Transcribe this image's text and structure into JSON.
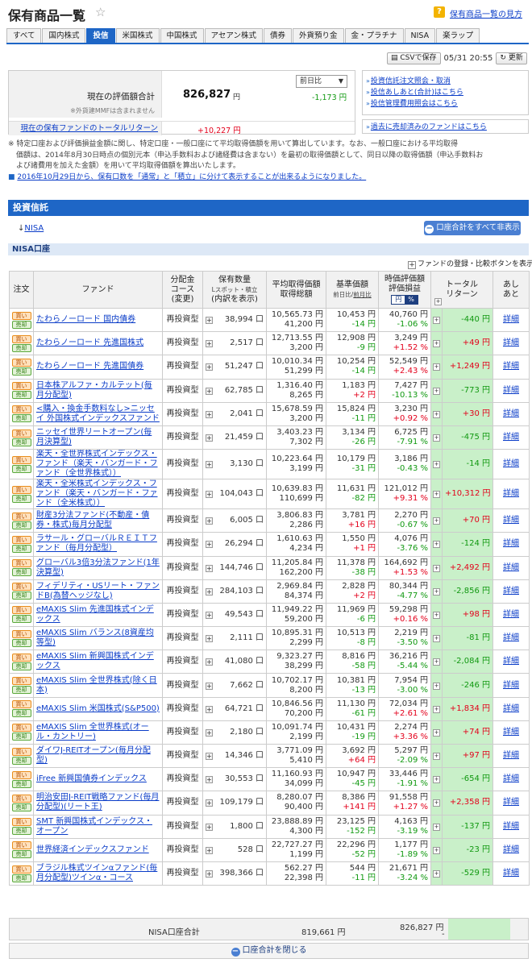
{
  "header": {
    "title": "保有商品一覧",
    "help": "保有商品一覧の見方"
  },
  "tabs": [
    "すべて",
    "国内株式",
    "投信",
    "米国株式",
    "中国株式",
    "アセアン株式",
    "債券",
    "外貨預り金",
    "金・プラチナ",
    "NISA",
    "楽ラップ"
  ],
  "active_tab": "投信",
  "toolbar": {
    "csv": "CSVで保存",
    "datetime": "05/31 20:55",
    "refresh": "更新"
  },
  "summary": {
    "value_label": "現在の評価額合計",
    "note": "※外貨建MMFは含まれません",
    "value": "826,827",
    "yen": "円",
    "compare_select": "前日比",
    "diff": "-1,173 円",
    "total_return_label": "現在の保有ファンドのトータルリターン",
    "total_return": "+10,227 円"
  },
  "links": [
    "投資信託注文照会・取消",
    "投信あしあと(合計)はこちら",
    "投信管理費用照会はこちら"
  ],
  "link_sold": "過去に売却済みのファンドはこちら",
  "notes": {
    "line1": "※ 特定口座および評価損益金額に関し、特定口座・一般口座にて平均取得価額を用いて算出しています。なお、一般口座における平均取得",
    "line2": "価額は、2014年8月30日時点の個別元本（申込手数料および諸経費は含まない）を最初の取得価額として、同日以降の取得価額（申込手数料お",
    "line3": "よび諸費用を加えた金額）を用いて平均取得価額を算出いたします。",
    "link": "2016年10月29日から、保有口数を「通常」と「積立」に分けて表示することが出来るようになりました。"
  },
  "section": {
    "title": "投資信託",
    "nisa_link": "NISA",
    "close_all": "口座合計をすべて非表示",
    "account": "NISA口座",
    "register_compare": "ファンドの登録・比較ボタンを表示"
  },
  "table": {
    "headers": {
      "order": "注文",
      "fund": "ファンド",
      "course1": "分配金",
      "course2": "コース",
      "course3": "(変更)",
      "qty1": "保有数量",
      "qty2": "Lスポット・積立",
      "qty3": "(内訳を表示)",
      "avg1": "平均取得価額",
      "avg2": "取得総額",
      "base1": "基準価額",
      "base2a": "前日比",
      "base2b": "前月比",
      "eval1": "時価評価額",
      "eval2": "評価損益",
      "pct_yen": "円",
      "pct_pct": "%",
      "ret1": "トータル",
      "ret2": "リターン",
      "ashi1": "あし",
      "ashi2": "あと"
    },
    "buy": "買い",
    "sell": "売却",
    "course": "再投資型",
    "unit": "口",
    "detail": "詳細",
    "rows": [
      {
        "name": "たわらノーロード 国内債券",
        "qty": "38,994",
        "avg": "10,565.73 円",
        "cost": "41,200 円",
        "base": "10,453 円",
        "bdiff": "-14 円",
        "eval": "40,760 円",
        "epct": "-1.06 %",
        "ret": "-440 円"
      },
      {
        "name": "たわらノーロード 先進国株式",
        "qty": "2,517",
        "avg": "12,713.55 円",
        "cost": "3,200 円",
        "base": "12,908 円",
        "bdiff": "-9 円",
        "eval": "3,249 円",
        "epct": "+1.52 %",
        "ret": "+49 円"
      },
      {
        "name": "たわらノーロード 先進国債券",
        "qty": "51,247",
        "avg": "10,010.34 円",
        "cost": "51,299 円",
        "base": "10,254 円",
        "bdiff": "-14 円",
        "eval": "52,549 円",
        "epct": "+2.43 %",
        "ret": "+1,249 円"
      },
      {
        "name": "日本株アルファ・カルテット(毎月分配型)",
        "qty": "62,785",
        "avg": "1,316.40 円",
        "cost": "8,265 円",
        "base": "1,183 円",
        "bdiff": "+2 円",
        "eval": "7,427 円",
        "epct": "-10.13 %",
        "ret": "-773 円"
      },
      {
        "name": "<購入・換金手数料なし>ニッセイ 外国株式インデックスファンド",
        "qty": "2,041",
        "avg": "15,678.59 円",
        "cost": "3,200 円",
        "base": "15,824 円",
        "bdiff": "-11 円",
        "eval": "3,230 円",
        "epct": "+0.92 %",
        "ret": "+30 円"
      },
      {
        "name": "ニッセイ世界リートオープン(毎月決算型)",
        "qty": "21,459",
        "avg": "3,403.23 円",
        "cost": "7,302 円",
        "base": "3,134 円",
        "bdiff": "-26 円",
        "eval": "6,725 円",
        "epct": "-7.91 %",
        "ret": "-475 円"
      },
      {
        "name": "楽天・全世界株式インデックス・ファンド（楽天・バンガード・ファンド（全世界株式））",
        "qty": "3,130",
        "avg": "10,223.64 円",
        "cost": "3,199 円",
        "base": "10,179 円",
        "bdiff": "-31 円",
        "eval": "3,186 円",
        "epct": "-0.43 %",
        "ret": "-14 円"
      },
      {
        "name": "楽天・全米株式インデックス・ファンド（楽天・バンガード・ファンド（全米株式））",
        "qty": "104,043",
        "avg": "10,639.83 円",
        "cost": "110,699 円",
        "base": "11,631 円",
        "bdiff": "-82 円",
        "eval": "121,012 円",
        "epct": "+9.31 %",
        "ret": "+10,312 円"
      },
      {
        "name": "財産3分法ファンド(不動産・債券・株式)毎月分配型",
        "qty": "6,005",
        "avg": "3,806.83 円",
        "cost": "2,286 円",
        "base": "3,781 円",
        "bdiff": "+16 円",
        "eval": "2,270 円",
        "epct": "-0.67 %",
        "ret": "+70 円"
      },
      {
        "name": "ラサール・グローバルＲＥＩＴファンド（毎月分配型）",
        "qty": "26,294",
        "avg": "1,610.63 円",
        "cost": "4,234 円",
        "base": "1,550 円",
        "bdiff": "+1 円",
        "eval": "4,076 円",
        "epct": "-3.76 %",
        "ret": "-124 円"
      },
      {
        "name": "グローバル3倍3分法ファンド(1年決算型)",
        "qty": "144,746",
        "avg": "11,205.84 円",
        "cost": "162,200 円",
        "base": "11,378 円",
        "bdiff": "-38 円",
        "eval": "164,692 円",
        "epct": "+1.53 %",
        "ret": "+2,492 円"
      },
      {
        "name": "フィデリティ・USリート・ファンドB(為替ヘッジなし)",
        "qty": "284,103",
        "avg": "2,969.84 円",
        "cost": "84,374 円",
        "base": "2,828 円",
        "bdiff": "+2 円",
        "eval": "80,344 円",
        "epct": "-4.77 %",
        "ret": "-2,856 円"
      },
      {
        "name": "eMAXIS Slim 先進国株式インデックス",
        "qty": "49,543",
        "avg": "11,949.22 円",
        "cost": "59,200 円",
        "base": "11,969 円",
        "bdiff": "-6 円",
        "eval": "59,298 円",
        "epct": "+0.16 %",
        "ret": "+98 円"
      },
      {
        "name": "eMAXIS Slim バランス(8資産均等型)",
        "qty": "2,111",
        "avg": "10,895.31 円",
        "cost": "2,299 円",
        "base": "10,513 円",
        "bdiff": "-8 円",
        "eval": "2,219 円",
        "epct": "-3.50 %",
        "ret": "-81 円"
      },
      {
        "name": "eMAXIS Slim 新興国株式インデックス",
        "qty": "41,080",
        "avg": "9,323.27 円",
        "cost": "38,299 円",
        "base": "8,816 円",
        "bdiff": "-58 円",
        "eval": "36,216 円",
        "epct": "-5.44 %",
        "ret": "-2,084 円"
      },
      {
        "name": "eMAXIS Slim 全世界株式(除く日本)",
        "qty": "7,662",
        "avg": "10,702.17 円",
        "cost": "8,200 円",
        "base": "10,381 円",
        "bdiff": "-13 円",
        "eval": "7,954 円",
        "epct": "-3.00 %",
        "ret": "-246 円"
      },
      {
        "name": "eMAXIS Slim 米国株式(S&P500)",
        "qty": "64,721",
        "avg": "10,846.56 円",
        "cost": "70,200 円",
        "base": "11,130 円",
        "bdiff": "-61 円",
        "eval": "72,034 円",
        "epct": "+2.61 %",
        "ret": "+1,834 円"
      },
      {
        "name": "eMAXIS Slim 全世界株式(オール・カントリー)",
        "qty": "2,180",
        "avg": "10,091.74 円",
        "cost": "2,199 円",
        "base": "10,431 円",
        "bdiff": "-19 円",
        "eval": "2,274 円",
        "epct": "+3.36 %",
        "ret": "+74 円"
      },
      {
        "name": "ダイワJ-REITオープン(毎月分配型)",
        "qty": "14,346",
        "avg": "3,771.09 円",
        "cost": "5,410 円",
        "base": "3,692 円",
        "bdiff": "+64 円",
        "eval": "5,297 円",
        "epct": "-2.09 %",
        "ret": "+97 円"
      },
      {
        "name": "iFree 新興国債券インデックス",
        "qty": "30,553",
        "avg": "11,160.93 円",
        "cost": "34,099 円",
        "base": "10,947 円",
        "bdiff": "-45 円",
        "eval": "33,446 円",
        "epct": "-1.91 %",
        "ret": "-654 円"
      },
      {
        "name": "明治安田J-REIT戦略ファンド(毎月分配型)(リート王)",
        "qty": "109,179",
        "avg": "8,280.07 円",
        "cost": "90,400 円",
        "base": "8,386 円",
        "bdiff": "+141 円",
        "eval": "91,558 円",
        "epct": "+1.27 %",
        "ret": "+2,358 円"
      },
      {
        "name": "SMT 新興国株式インデックス・オープン",
        "qty": "1,800",
        "avg": "23,888.89 円",
        "cost": "4,300 円",
        "base": "23,125 円",
        "bdiff": "-152 円",
        "eval": "4,163 円",
        "epct": "-3.19 %",
        "ret": "-137 円"
      },
      {
        "name": "世界経済インデックスファンド",
        "qty": "528",
        "avg": "22,727.27 円",
        "cost": "1,199 円",
        "base": "22,296 円",
        "bdiff": "-52 円",
        "eval": "1,177 円",
        "epct": "-1.89 %",
        "ret": "-23 円"
      },
      {
        "name": "ブラジル株式ツインαファンド(毎月分配型)ツインα・コース",
        "qty": "398,366",
        "avg": "562.27 円",
        "cost": "22,398 円",
        "base": "544 円",
        "bdiff": "-11 円",
        "eval": "21,671 円",
        "epct": "-3.24 %",
        "ret": "-529 円"
      }
    ],
    "total": {
      "label": "NISA口座合計",
      "cost": "819,661 円",
      "eval": "826,827 円",
      "dash": "-"
    }
  },
  "close_account": "口座合計を閉じる",
  "colors": {
    "accent": "#1e66c6",
    "positive": "#e3001b",
    "negative": "#119911",
    "return_bg": "#c9f0c9"
  }
}
